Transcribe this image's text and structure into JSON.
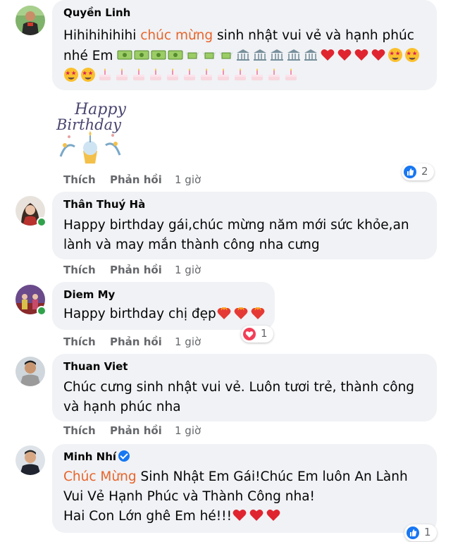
{
  "comments": [
    {
      "author": "Quyền Linh",
      "line1_pre": "Hihihihihihi ",
      "line1_hl": "chúc mừng",
      "line1_post": " sinh nhật vui vẻ và hạnh phúc",
      "line2": "nhé Em",
      "line2_emojis": [
        "money-icon",
        "money-icon",
        "money-icon",
        "money-icon",
        "money-with-wings-icon",
        "money-with-wings-icon",
        "money-with-wings-icon",
        "bank-icon",
        "bank-icon",
        "bank-icon",
        "bank-icon",
        "bank-icon",
        "heart-icon",
        "heart-icon",
        "heart-icon",
        "heart-icon",
        "star-struck-icon",
        "star-struck-icon"
      ],
      "line3_emojis": [
        "star-struck-icon",
        "star-struck-icon",
        "cake-icon",
        "cake-icon",
        "cake-icon",
        "cake-icon",
        "cake-icon",
        "cake-icon",
        "cake-icon",
        "cake-icon",
        "cake-icon",
        "cake-icon",
        "cake-icon",
        "cake-icon"
      ],
      "sticker_text1": "Happy",
      "sticker_text2": "Birthday",
      "like": "Thích",
      "reply": "Phản hồi",
      "time": "1 giờ",
      "reaction_count": "2"
    },
    {
      "author": "Thân Thuý Hà",
      "line1": "Happy birthday gái,chúc mừng năm mới sức khỏe,an",
      "line2": "lành và may mắn thành công nha cưng",
      "like": "Thích",
      "reply": "Phản hồi",
      "time": "1 giờ"
    },
    {
      "author": "Diem My",
      "line1": "Happy birthday chị đẹp",
      "line1_emojis": [
        "heart-on-fire-icon",
        "heart-on-fire-icon",
        "heart-on-fire-icon"
      ],
      "like": "Thích",
      "reply": "Phản hồi",
      "time": "1 giờ",
      "reaction_count": "1"
    },
    {
      "author": "Thuan Viet",
      "line1": "Chúc cưng sinh nhật vui vẻ. Luôn tươi trẻ, thành công",
      "line2": "và hạnh phúc nha",
      "like": "Thích",
      "reply": "Phản hồi",
      "time": "1 giờ"
    },
    {
      "author": "Minh Nhí",
      "line1_hl": "Chúc Mừng",
      "line1_post": " Sinh Nhật Em Gái!Chúc Em luôn An Lành",
      "line2": "Vui Vẻ Hạnh Phúc và Thành Công nha!",
      "line3": "Hai Con Lớn ghê Em hé!!!",
      "line3_emojis": [
        "heart-icon",
        "heart-icon",
        "heart-icon"
      ],
      "reaction_count": "1"
    }
  ],
  "colors": {
    "bubble": "#f0f2f5",
    "highlight": "#e8642a",
    "meta": "#65676b",
    "like_blue": "#1877f2",
    "heart": "#f33e58"
  }
}
